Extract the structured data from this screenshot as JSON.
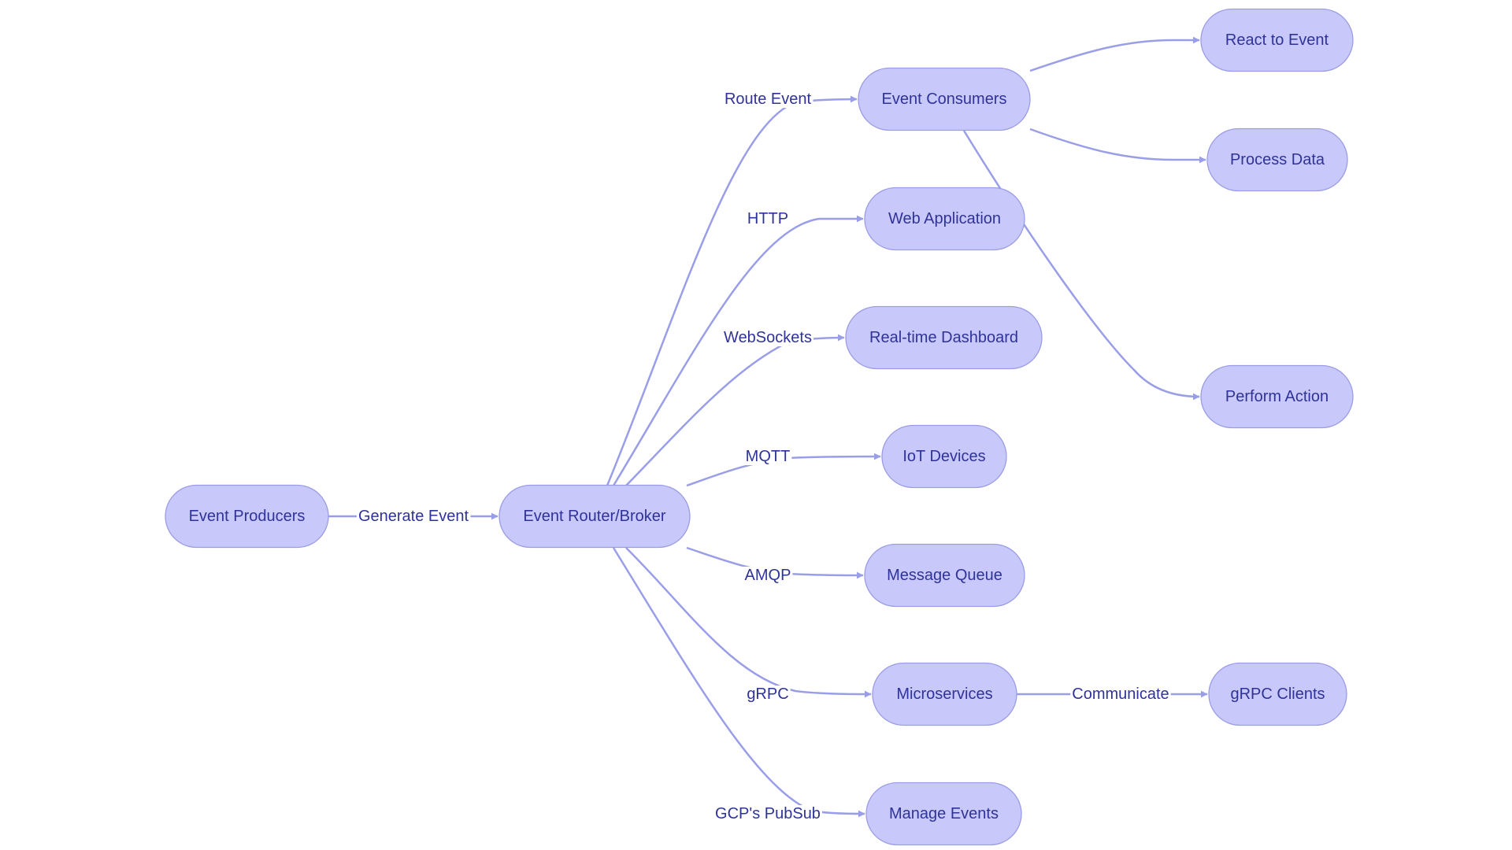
{
  "diagram": {
    "type": "flowchart",
    "direction": "left-to-right",
    "colors": {
      "node_fill": "#c8c9fa",
      "node_stroke": "#9b9ce6",
      "text": "#2f3399",
      "edge": "#9a9ee8",
      "background": "#ffffff"
    },
    "nodes": [
      {
        "id": "producers",
        "label": "Event Producers"
      },
      {
        "id": "broker",
        "label": "Event Router/Broker"
      },
      {
        "id": "consumers",
        "label": "Event Consumers"
      },
      {
        "id": "webapp",
        "label": "Web Application"
      },
      {
        "id": "dashboard",
        "label": "Real-time Dashboard"
      },
      {
        "id": "iot",
        "label": "IoT Devices"
      },
      {
        "id": "mq",
        "label": "Message Queue"
      },
      {
        "id": "micro",
        "label": "Microservices"
      },
      {
        "id": "manage",
        "label": "Manage Events"
      },
      {
        "id": "react",
        "label": "React to Event"
      },
      {
        "id": "process",
        "label": "Process Data"
      },
      {
        "id": "perform",
        "label": "Perform Action"
      },
      {
        "id": "grpcclients",
        "label": "gRPC Clients"
      }
    ],
    "edges": [
      {
        "from": "producers",
        "to": "broker",
        "label": "Generate Event"
      },
      {
        "from": "broker",
        "to": "consumers",
        "label": "Route Event"
      },
      {
        "from": "broker",
        "to": "webapp",
        "label": "HTTP"
      },
      {
        "from": "broker",
        "to": "dashboard",
        "label": "WebSockets"
      },
      {
        "from": "broker",
        "to": "iot",
        "label": "MQTT"
      },
      {
        "from": "broker",
        "to": "mq",
        "label": "AMQP"
      },
      {
        "from": "broker",
        "to": "micro",
        "label": "gRPC"
      },
      {
        "from": "broker",
        "to": "manage",
        "label": "GCP's PubSub"
      },
      {
        "from": "consumers",
        "to": "react",
        "label": ""
      },
      {
        "from": "consumers",
        "to": "process",
        "label": ""
      },
      {
        "from": "consumers",
        "to": "perform",
        "label": ""
      },
      {
        "from": "micro",
        "to": "grpcclients",
        "label": "Communicate"
      }
    ]
  }
}
